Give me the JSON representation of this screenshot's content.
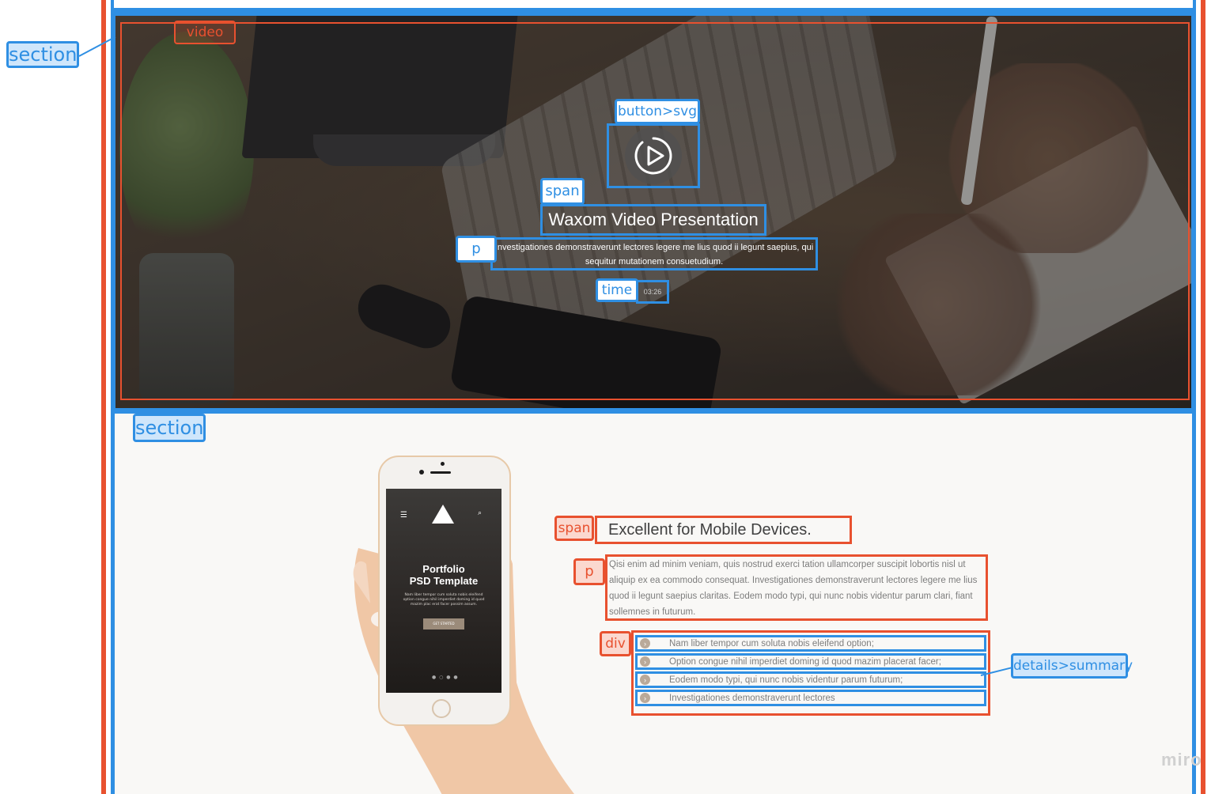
{
  "tags": {
    "section_top": "section",
    "video": "video",
    "button_svg": "button>svg",
    "span_video": "span",
    "p_video": "p",
    "time": "time",
    "section_mobile": "section",
    "span_mobile": "span",
    "p_mobile": "p",
    "div_mobile": "div",
    "details_summary": "details>summary"
  },
  "video": {
    "play_icon": "play-circle-icon",
    "title": "Waxom Video Presentation",
    "description": "Investigationes demonstraverunt lectores legere me lius quod ii legunt saepius, qui sequitur mutationem consuetudium.",
    "time": "03:26"
  },
  "phone_screen": {
    "menu_icon": "hamburger-icon",
    "logo_icon": "triangle-logo-icon",
    "search_icon": "search-icon",
    "title_line1": "Portfolio",
    "title_line2": "PSD Template",
    "body": "Nam liber tempor cum soluta nobis eleifend option congue nihil imperdiet doming id quod mazim plac erat facer possim assum.",
    "button": "GET STARTED"
  },
  "mobile": {
    "heading": "Excellent for Mobile Devices.",
    "paragraph": "Qisi enim ad minim veniam, quis nostrud exerci tation ullamcorper suscipit lobortis nisl ut aliquip ex ea commodo consequat. Investigationes demonstraverunt lectores legere me lius quod ii legunt saepius claritas. Eodem modo typi, qui nunc nobis videntur parum clari, fiant sollemnes in futurum.",
    "items": [
      "Nam liber tempor cum soluta nobis eleifend option;",
      "Option congue nihil imperdiet doming id quod mazim placerat facer;",
      "Eodem modo typi, qui nunc nobis videntur parum futurum;",
      "Investigationes demonstraverunt lectores"
    ]
  },
  "watermark": "miro",
  "colors": {
    "annotation_blue": "#2f8fe3",
    "annotation_red": "#e8512f"
  }
}
